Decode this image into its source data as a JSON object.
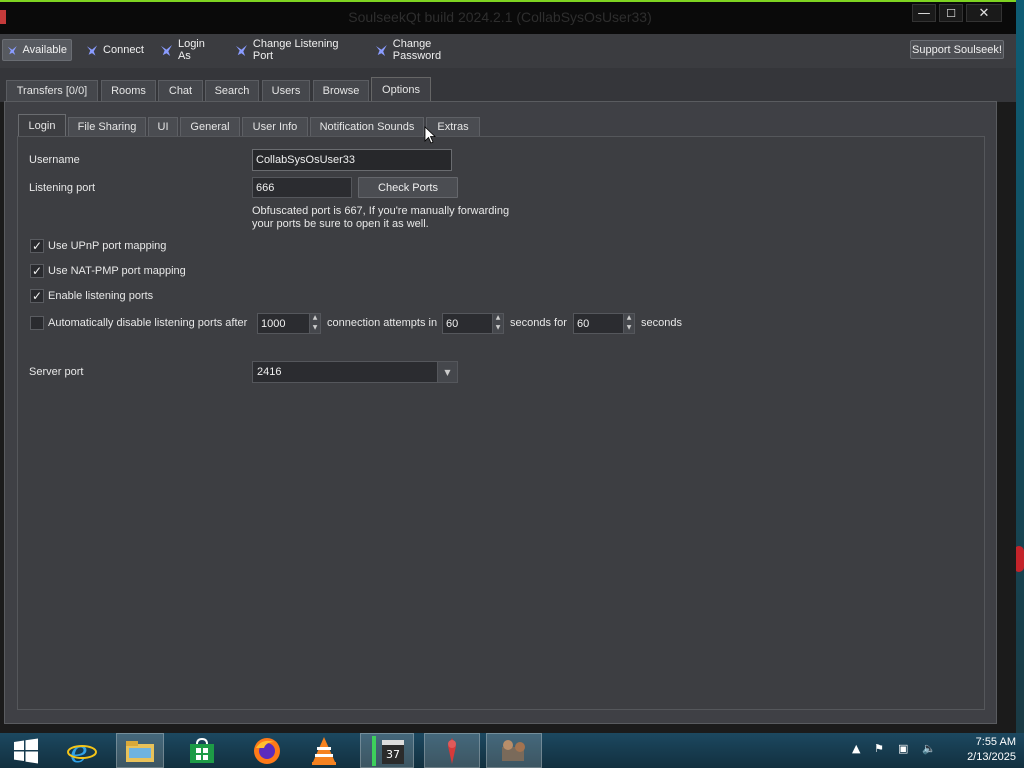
{
  "window": {
    "title": "SoulseekQt build 2024.2.1 (CollabSysOsUser33)",
    "controls": {
      "minimize": "—",
      "maximize": "☐",
      "close": "✕"
    }
  },
  "toolbar": {
    "items": [
      {
        "label": "Available",
        "icon": "bird-icon",
        "active": true
      },
      {
        "label": "Connect",
        "icon": "bird-icon"
      },
      {
        "label": "Login As",
        "icon": "bird-icon"
      },
      {
        "label": "Change Listening Port",
        "icon": "bird-icon"
      },
      {
        "label": "Change Password",
        "icon": "bird-icon"
      }
    ],
    "support_label": "Support Soulseek!"
  },
  "main_tabs": [
    {
      "label": "Transfers [0/0]"
    },
    {
      "label": "Rooms"
    },
    {
      "label": "Chat"
    },
    {
      "label": "Search"
    },
    {
      "label": "Users"
    },
    {
      "label": "Browse"
    },
    {
      "label": "Options",
      "active": true
    }
  ],
  "sub_tabs": [
    {
      "label": "Login",
      "active": true
    },
    {
      "label": "File Sharing"
    },
    {
      "label": "UI"
    },
    {
      "label": "General"
    },
    {
      "label": "User Info"
    },
    {
      "label": "Notification Sounds"
    },
    {
      "label": "Extras"
    }
  ],
  "login": {
    "username_label": "Username",
    "username_value": "CollabSysOsUser33",
    "port_label": "Listening port",
    "port_value": "666",
    "check_ports_label": "Check Ports",
    "obfuscated_note_line1": "Obfuscated port is 667, If you're manually forwarding",
    "obfuscated_note_line2": "your ports be sure to open it as well.",
    "upnp": {
      "label": "Use UPnP port mapping",
      "checked": true
    },
    "natpmp": {
      "label": "Use NAT-PMP port mapping",
      "checked": true
    },
    "enable_ports": {
      "label": "Enable listening ports",
      "checked": true
    },
    "auto_disable": {
      "label": "Automatically disable listening ports after",
      "checked": false,
      "attempts_value": "1000",
      "attempts_label": "connection attempts in",
      "seconds1_value": "60",
      "seconds_for_label": "seconds for",
      "seconds2_value": "60",
      "seconds_label": "seconds"
    },
    "server_port_label": "Server port",
    "server_port_value": "2416"
  },
  "taskbar": {
    "clock_time": "7:55 AM",
    "clock_date": "2/13/2025",
    "icons": [
      "windows-start-icon",
      "internet-explorer-icon",
      "file-explorer-icon",
      "store-icon",
      "firefox-icon",
      "vlc-icon",
      "media-player-icon",
      "soulseek-icon",
      "game-icon"
    ]
  },
  "colors": {
    "window_bg": "#3f4045",
    "toolbar_bg": "#3b3c40",
    "titlebar_bg": "#0a0a0a",
    "accent_green": "#7ed321",
    "taskbar_bg": "#14374a"
  }
}
